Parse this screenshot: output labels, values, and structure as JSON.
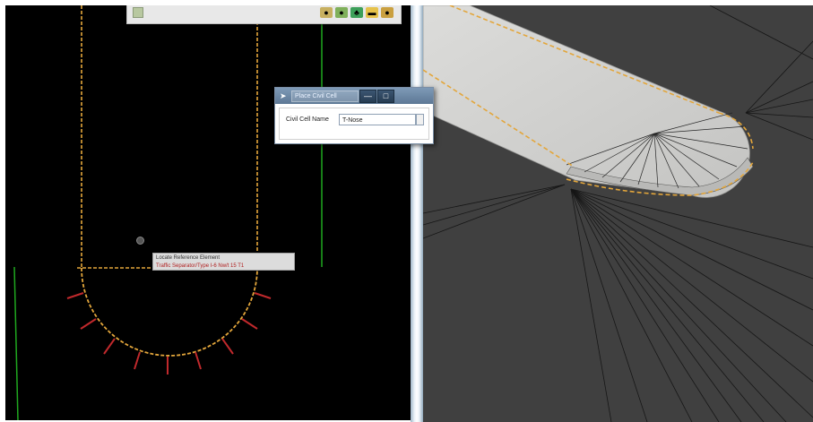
{
  "toolbar": {
    "icons": [
      "tool-icon",
      "route-icon",
      "tree-icon",
      "folder-icon",
      "lock-icon"
    ]
  },
  "tooltip": {
    "line1": "Locate Reference Element",
    "line2": "Traffic Separator/Type I-6 Nw/t 15 T1"
  },
  "dialog": {
    "title": "Place Civil Cell",
    "minimize": "—",
    "maximize": "□",
    "label": "Civil Cell Name",
    "value": "T-Nose"
  },
  "colors": {
    "view2d_background": "#000000",
    "view3d_background": "#404040",
    "dashed_line": "#e3a63b",
    "green_line": "#1fa81f",
    "red_tick": "#c0292c",
    "road_surface": "#d2d2d0"
  }
}
